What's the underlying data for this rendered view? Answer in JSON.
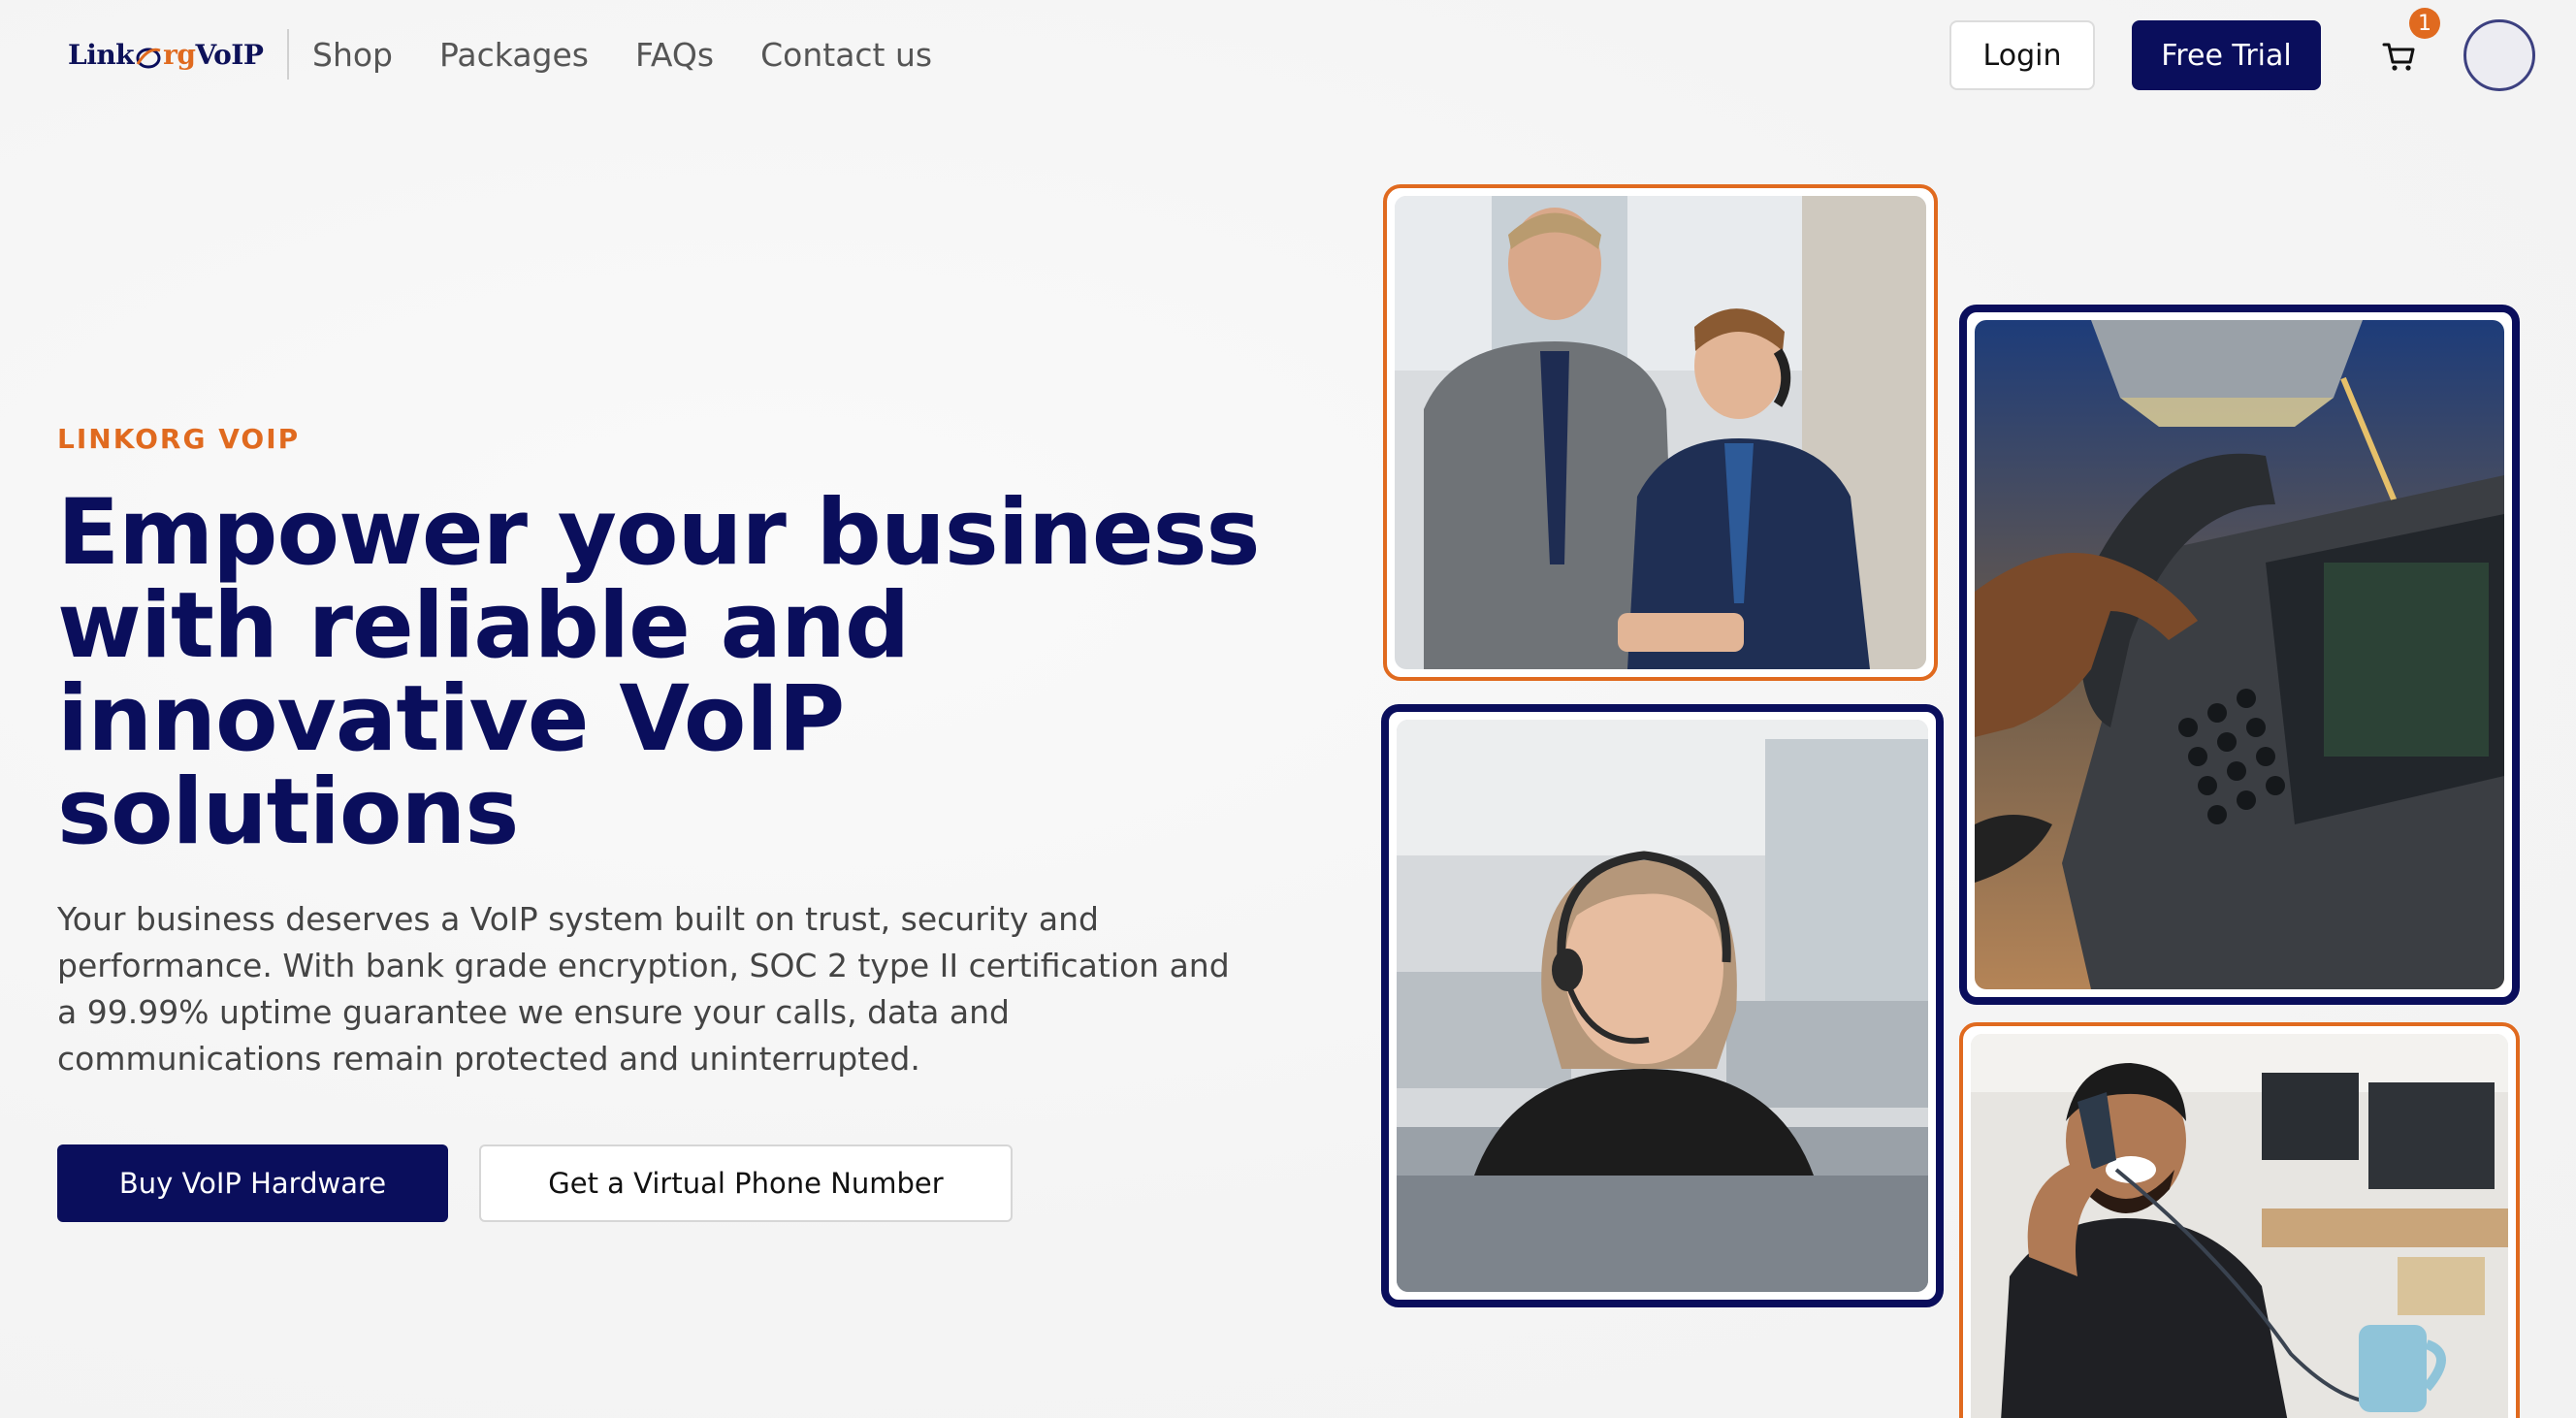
{
  "header": {
    "logo": {
      "text_a": "Link",
      "text_b": "rg",
      "text_c": "VoIP"
    },
    "nav": [
      "Shop",
      "Packages",
      "FAQs",
      "Contact us"
    ],
    "login_label": "Login",
    "trial_label": "Free Trial",
    "cart_count": "1"
  },
  "hero": {
    "eyebrow": "LINKORG VOIP",
    "headline": "Empower your business with reliable and innovative VoIP solutions",
    "body": "Your business deserves a VoIP system built on trust, security and performance. With bank grade encryption, SOC 2 type II certification and a 99.99% uptime guarantee we ensure your calls, data and communications remain protected and uninterrupted.",
    "primary_cta": "Buy VoIP Hardware",
    "secondary_cta": "Get a Virtual Phone Number"
  },
  "colors": {
    "brand_navy": "#0a0e5c",
    "brand_orange": "#e06a1f"
  },
  "tiles": [
    {
      "frame": "orange",
      "subject": "two-men-at-laptop-photo"
    },
    {
      "frame": "navy",
      "subject": "woman-with-headset-photo"
    },
    {
      "frame": "navy",
      "subject": "desk-phone-handset-photo"
    },
    {
      "frame": "orange",
      "subject": "man-laughing-on-phone-photo"
    }
  ]
}
